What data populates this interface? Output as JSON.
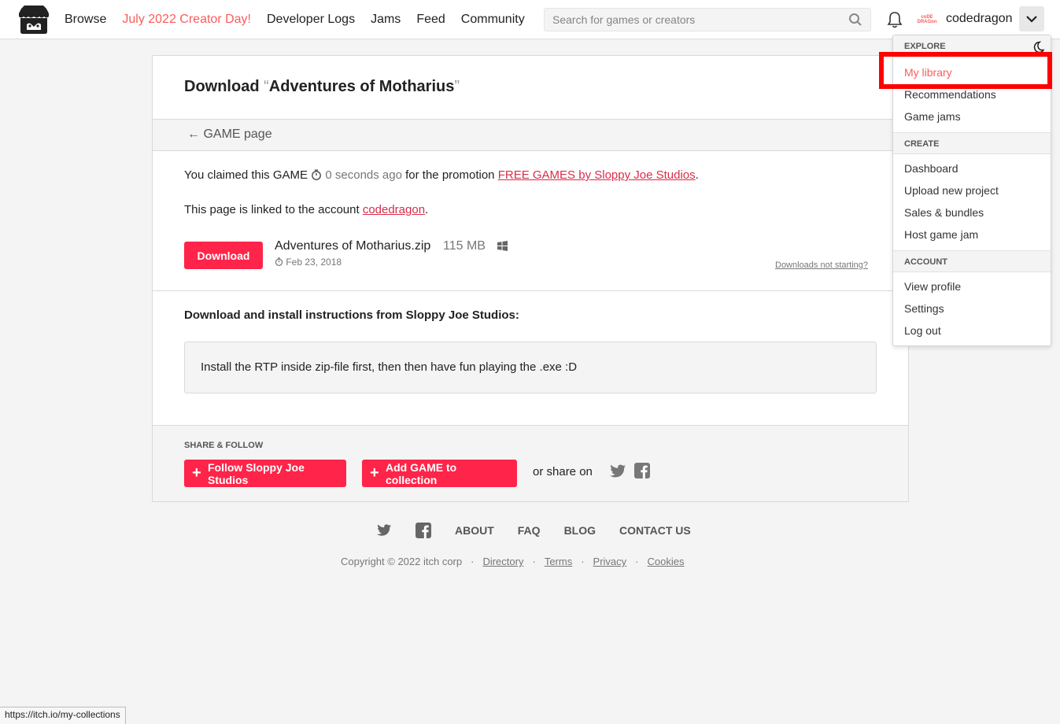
{
  "header": {
    "nav": [
      "Browse",
      "July 2022 Creator Day!",
      "Developer Logs",
      "Jams",
      "Feed",
      "Community"
    ],
    "search_placeholder": "Search for games or creators",
    "avatar_text": [
      "coDE",
      "DRAGon"
    ],
    "username": "codedragon"
  },
  "page": {
    "title_prefix": "Download",
    "title_open_quote": "“",
    "title_name": "Adventures of Motharius",
    "title_close_quote": "”",
    "back_label": "← GAME page",
    "claim": {
      "prefix": "You claimed this GAME",
      "time": "0 seconds ago",
      "middle": "for the promotion",
      "promo_link": "FREE GAMES by Sloppy Joe Studios",
      "suffix": "."
    },
    "linked": {
      "prefix": "This page is linked to the account",
      "account": "codedragon",
      "suffix": "."
    },
    "download_label": "Download",
    "file": {
      "name": "Adventures of Motharius.zip",
      "size": "115 MB",
      "date": "Feb 23, 2018"
    },
    "not_starting": "Downloads not starting?",
    "instructions_title": "Download and install instructions from Sloppy Joe Studios:",
    "instructions": "Install the RTP inside zip-file first, then then have fun playing the .exe :D",
    "share_label": "SHARE & FOLLOW",
    "follow_label": "Follow Sloppy Joe Studios",
    "collection_label": "Add GAME to collection",
    "or_share": "or share on"
  },
  "footer": {
    "links": [
      "ABOUT",
      "FAQ",
      "BLOG",
      "CONTACT US"
    ],
    "copyright": "Copyright © 2022 itch corp",
    "legal": [
      "Directory",
      "Terms",
      "Privacy",
      "Cookies"
    ],
    "separator": "·"
  },
  "menu": {
    "sections": [
      {
        "title": "EXPLORE",
        "items": [
          "My library",
          "Recommendations",
          "Game jams"
        ]
      },
      {
        "title": "CREATE",
        "items": [
          "Dashboard",
          "Upload new project",
          "Sales & bundles",
          "Host game jam"
        ]
      },
      {
        "title": "ACCOUNT",
        "items": [
          "View profile",
          "Settings",
          "Log out"
        ]
      }
    ]
  },
  "status_url": "https://itch.io/my-collections",
  "colors": {
    "accent": "#ff2449",
    "link": "#da2c49",
    "highlight_box": "#ff0000"
  }
}
